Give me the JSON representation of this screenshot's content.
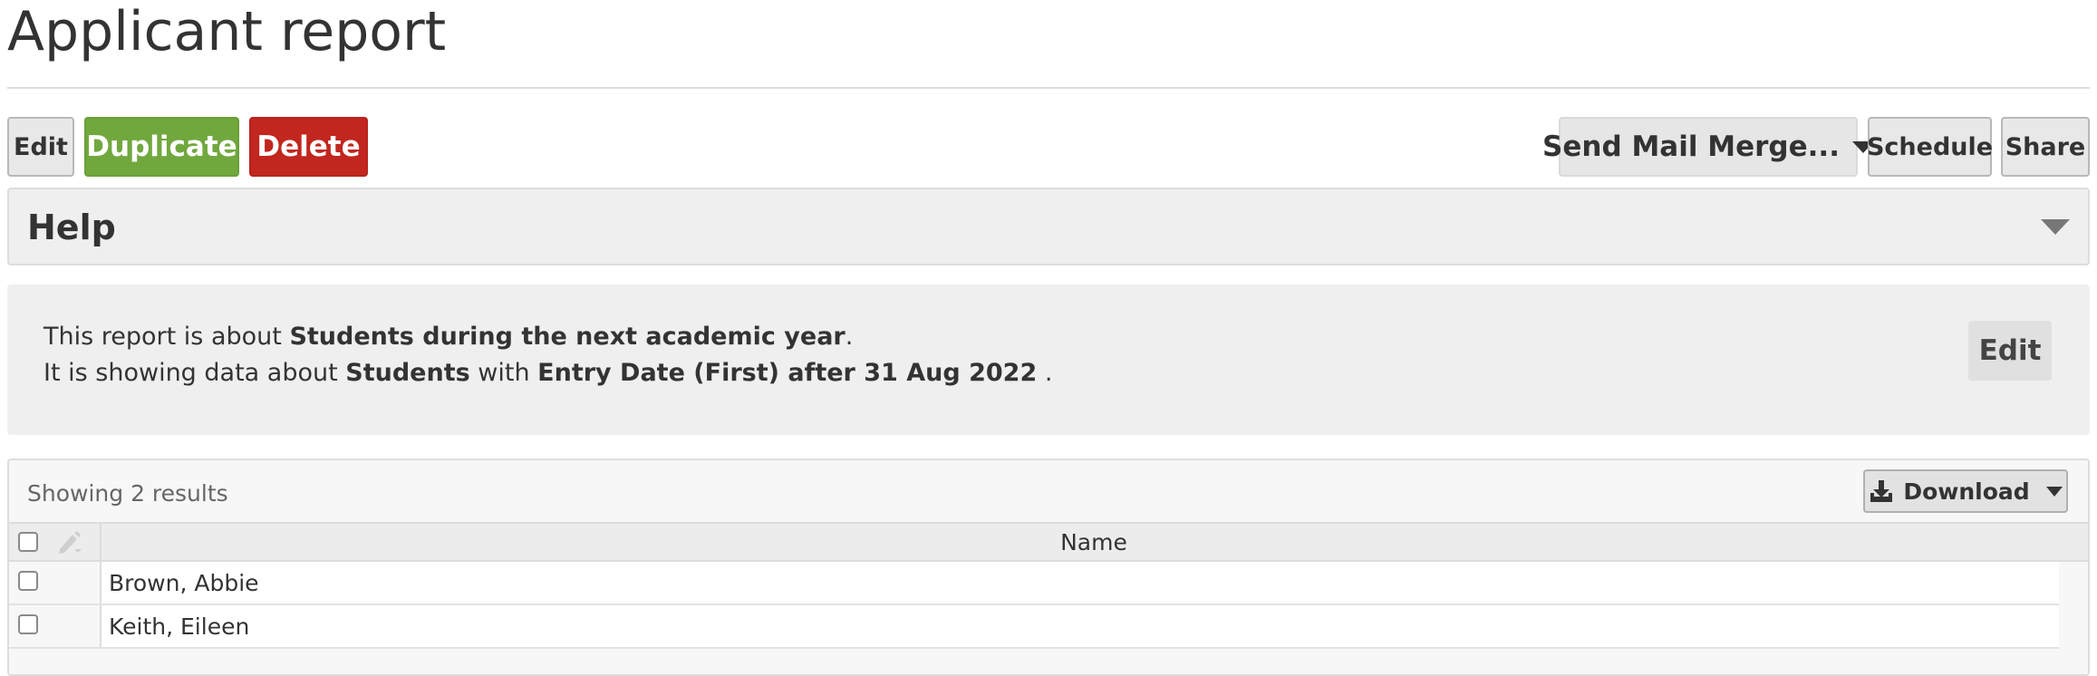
{
  "page": {
    "title": "Applicant report"
  },
  "toolbar": {
    "edit_label": "Edit",
    "duplicate_label": "Duplicate",
    "delete_label": "Delete",
    "mail_merge_label": "Send Mail Merge...",
    "schedule_label": "Schedule",
    "share_label": "Share"
  },
  "help": {
    "title": "Help",
    "expanded": false
  },
  "about": {
    "line1_prefix": "This report is about ",
    "line1_bold": "Students during the next academic year",
    "line1_suffix": ".",
    "line2_prefix": "It is showing data about ",
    "line2_bold1": "Students",
    "line2_mid": " with ",
    "line2_bold2": "Entry Date (First) after 31 Aug 2022",
    "line2_suffix": " .",
    "edit_label": "Edit"
  },
  "results": {
    "summary": "Showing 2 results",
    "download_label": "Download",
    "columns": [
      "Name"
    ],
    "rows": [
      {
        "name": "Brown, Abbie",
        "selected": false
      },
      {
        "name": "Keith, Eileen",
        "selected": false
      }
    ]
  },
  "colors": {
    "duplicate": "#71a83e",
    "delete": "#c1261f",
    "panel": "#efefef"
  },
  "icons": {
    "mail_merge_caret": "chevron-down-icon",
    "help_caret": "chevron-down-icon",
    "download": "download-icon",
    "bulk_edit": "pencil-icon"
  }
}
